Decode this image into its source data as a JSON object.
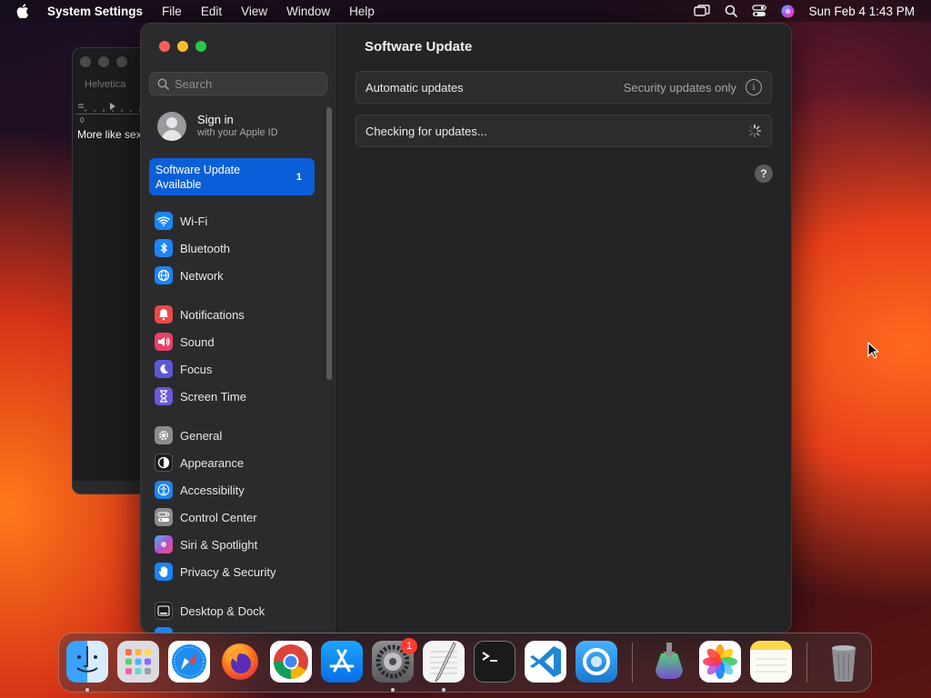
{
  "menubar": {
    "app_name": "System Settings",
    "menus": [
      "File",
      "Edit",
      "View",
      "Window",
      "Help"
    ],
    "clock": "Sun Feb 4  1:43 PM"
  },
  "background_window": {
    "font_label": "Helvetica",
    "ruler_zero": "0",
    "text": "More like sex"
  },
  "sidebar": {
    "search_placeholder": "Search",
    "signin_title": "Sign in",
    "signin_subtitle": "with your Apple ID",
    "update_line1": "Software Update",
    "update_line2": "Available",
    "update_badge": "1",
    "items": [
      {
        "label": "Wi-Fi",
        "icon": "wifi-icon",
        "color": "#1c84f5"
      },
      {
        "label": "Bluetooth",
        "icon": "bluetooth-icon",
        "color": "#1c84f5"
      },
      {
        "label": "Network",
        "icon": "globe-icon",
        "color": "#1c84f5"
      },
      {
        "label": "Notifications",
        "icon": "bell-icon",
        "color": "#ea4a46"
      },
      {
        "label": "Sound",
        "icon": "speaker-icon",
        "color": "#e8416a"
      },
      {
        "label": "Focus",
        "icon": "moon-icon",
        "color": "#5c59d6"
      },
      {
        "label": "Screen Time",
        "icon": "hourglass-icon",
        "color": "#6a5ad7"
      },
      {
        "label": "General",
        "icon": "gear-icon",
        "color": "#8c8c90"
      },
      {
        "label": "Appearance",
        "icon": "appearance-icon",
        "color": "#1c1c1e"
      },
      {
        "label": "Accessibility",
        "icon": "accessibility-icon",
        "color": "#1c84f5"
      },
      {
        "label": "Control Center",
        "icon": "control-center-icon",
        "color": "#8c8c90"
      },
      {
        "label": "Siri & Spotlight",
        "icon": "siri-icon",
        "color": "#b54fc6"
      },
      {
        "label": "Privacy & Security",
        "icon": "hand-icon",
        "color": "#1c84f5"
      },
      {
        "label": "Desktop & Dock",
        "icon": "desktop-icon",
        "color": "#1c1c1e"
      }
    ]
  },
  "content": {
    "title": "Software Update",
    "auto_updates_label": "Automatic updates",
    "auto_updates_value": "Security updates only",
    "checking_label": "Checking for updates...",
    "help_label": "?"
  },
  "dock": {
    "apps": [
      {
        "name": "Finder",
        "icon": "finder-icon"
      },
      {
        "name": "Launchpad",
        "icon": "launchpad-icon"
      },
      {
        "name": "Safari",
        "icon": "safari-icon"
      },
      {
        "name": "Firefox",
        "icon": "firefox-icon"
      },
      {
        "name": "Chrome",
        "icon": "chrome-icon"
      },
      {
        "name": "App Store",
        "icon": "app-store-icon"
      },
      {
        "name": "System Settings",
        "icon": "settings-icon",
        "badge": "1"
      },
      {
        "name": "TextEdit",
        "icon": "textedit-icon"
      },
      {
        "name": "Terminal",
        "icon": "terminal-icon"
      },
      {
        "name": "VS Code",
        "icon": "vscode-icon"
      },
      {
        "name": "Screen Recorder",
        "icon": "recorder-icon"
      },
      {
        "name": "Installer",
        "icon": "installer-icon"
      },
      {
        "name": "Photos",
        "icon": "photos-icon"
      },
      {
        "name": "Notes",
        "icon": "notes-icon"
      },
      {
        "name": "Trash",
        "icon": "trash-icon"
      }
    ]
  }
}
